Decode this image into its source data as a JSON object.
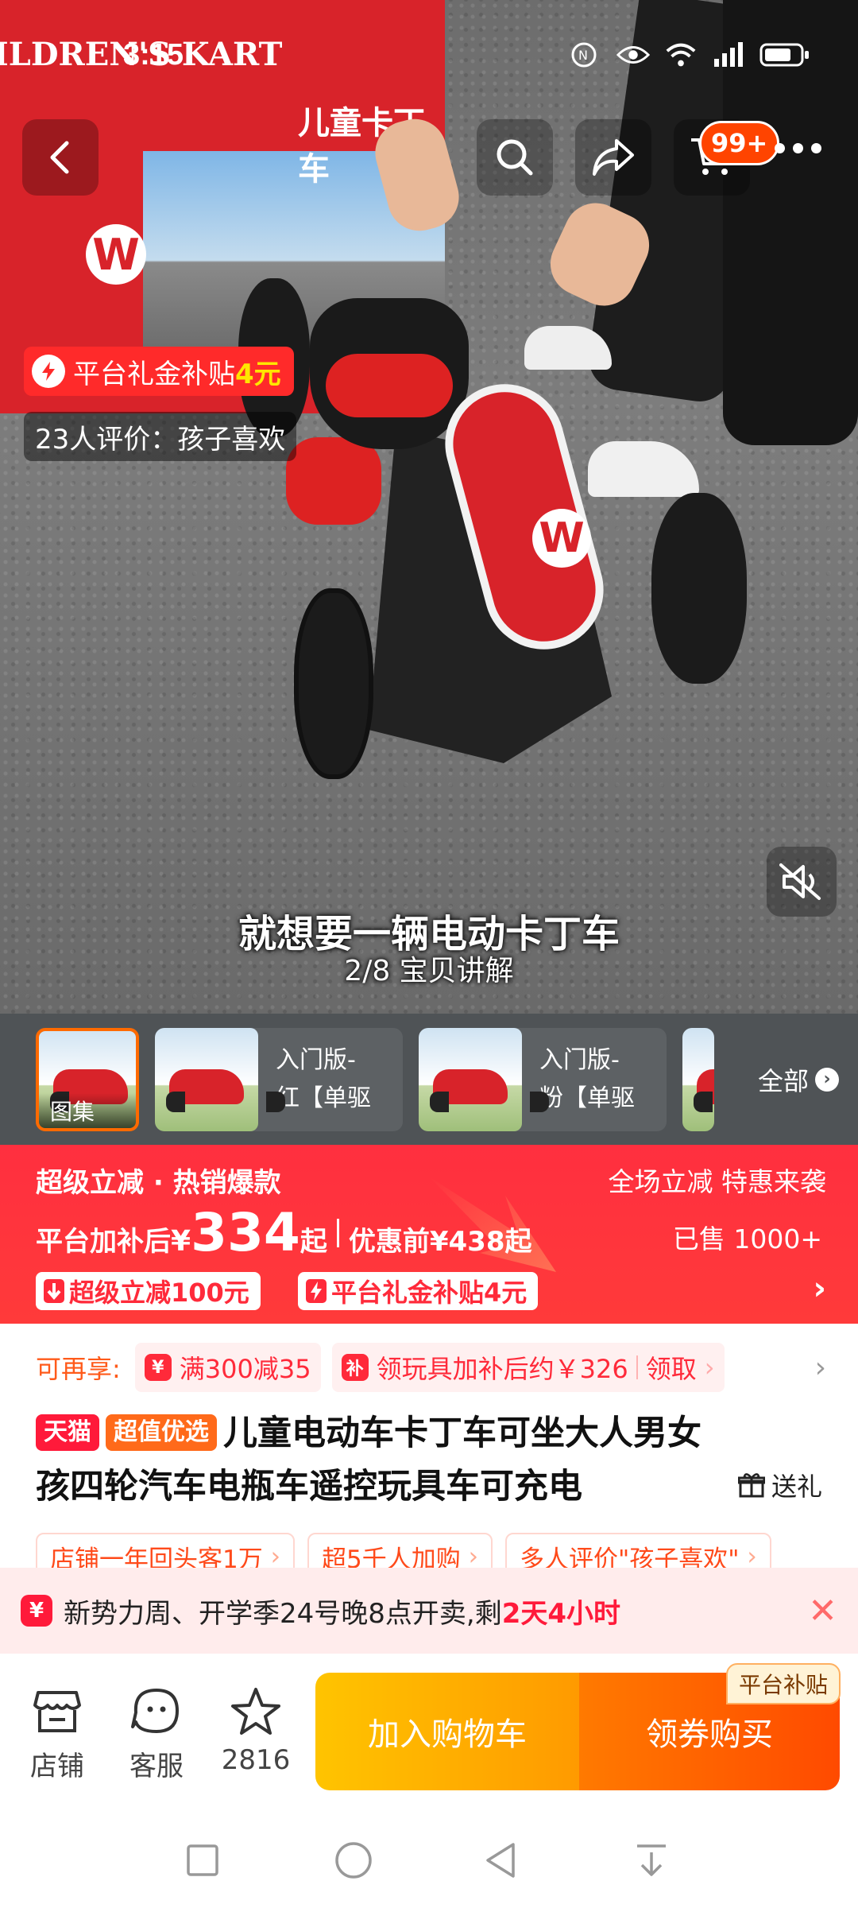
{
  "status_bar": {
    "time": "3:15"
  },
  "top_nav": {
    "cart_badge": "99+"
  },
  "media": {
    "box_text_cn": "儿童卡丁车",
    "box_text_en": "ILDREN'S KART",
    "logo_letter": "W",
    "subsidy_tag": {
      "text": "平台礼金补贴",
      "amount": "4元"
    },
    "review_tag": "23人评价：孩子喜欢",
    "subtitle": "就想要一辆电动卡丁车",
    "progress": "2/8 宝贝讲解"
  },
  "thumbnails": {
    "first_label": "图集",
    "items": [
      {
        "line1": "入门版-",
        "line2": "红【单驱"
      },
      {
        "line1": "入门版-",
        "line2": "粉【单驱"
      }
    ],
    "all_label": "全部"
  },
  "promo": {
    "title": "超级立减 · 热销爆款",
    "right_text": "全场立减 特惠来袭",
    "price_label": "平台加补后",
    "currency": "¥",
    "price": "334",
    "price_suffix": "起",
    "original": "优惠前¥438起",
    "sold": "已售 1000+",
    "chip1": "超级立减100元",
    "chip2": "平台礼金补贴4元"
  },
  "coupons": {
    "lead": "可再享:",
    "c1": "满300减35",
    "c2_text": "领玩具加补后约￥326",
    "c2_action": "领取"
  },
  "product": {
    "badge_tmall": "天猫",
    "badge_value": "超值优选",
    "title": "儿童电动车卡丁车可坐大人男女孩四轮汽车电瓶车遥控玩具车可充电",
    "gift": "送礼"
  },
  "highlights": [
    "店铺一年回头客1万",
    "超5千人加购",
    "多人评价\"孩子喜欢\""
  ],
  "notice": {
    "text": "新势力周、开学季24号晚8点开卖,剩",
    "countdown": "2天4小时"
  },
  "action_bar": {
    "store": "店铺",
    "service": "客服",
    "fav_count": "2816",
    "add_cart": "加入购物车",
    "buy": "领券购买",
    "buy_tag": "平台补贴"
  },
  "colors": {
    "accent_red": "#ff2f3f",
    "accent_orange": "#ff6a00",
    "cart_yellow": "#ffc400"
  }
}
